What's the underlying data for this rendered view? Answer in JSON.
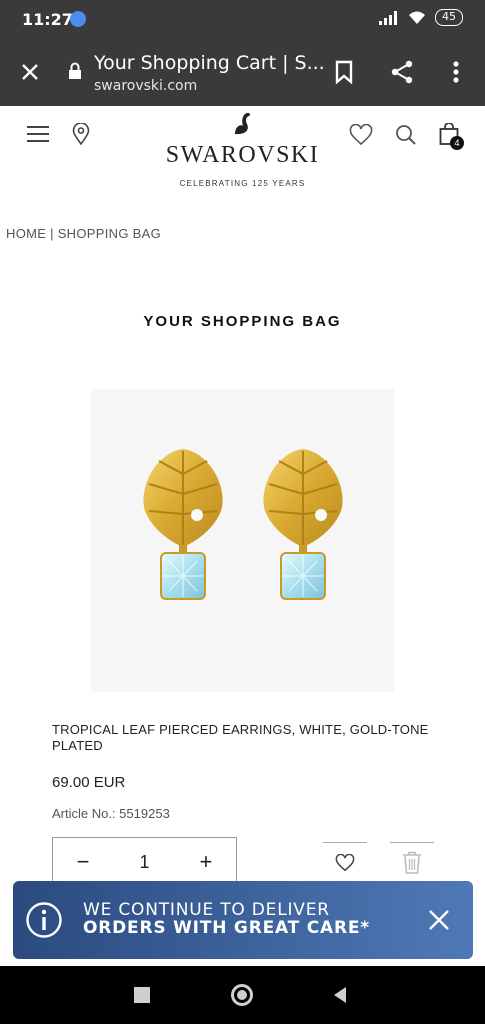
{
  "status": {
    "time": "11:27",
    "battery": "45"
  },
  "browser": {
    "title": "Your Shopping Cart | S...",
    "domain": "swarovski.com"
  },
  "header": {
    "logo": "SWAROVSKI",
    "tagline": "CELEBRATING 125 YEARS",
    "bag_count": "4"
  },
  "breadcrumb": "HOME | SHOPPING BAG",
  "page_title": "YOUR SHOPPING BAG",
  "product": {
    "name": "TROPICAL LEAF PIERCED EARRINGS, WHITE, GOLD-TONE PLATED",
    "price": "69.00 EUR",
    "article": "Article No.: 5519253",
    "quantity": "1",
    "minus": "−",
    "plus": "+"
  },
  "banner": {
    "line1": "WE CONTINUE TO DELIVER",
    "line2": "ORDERS WITH GREAT CARE*"
  },
  "colors": {
    "banner": "#3a5f9a",
    "dark_bar": "#3a3a3a"
  }
}
